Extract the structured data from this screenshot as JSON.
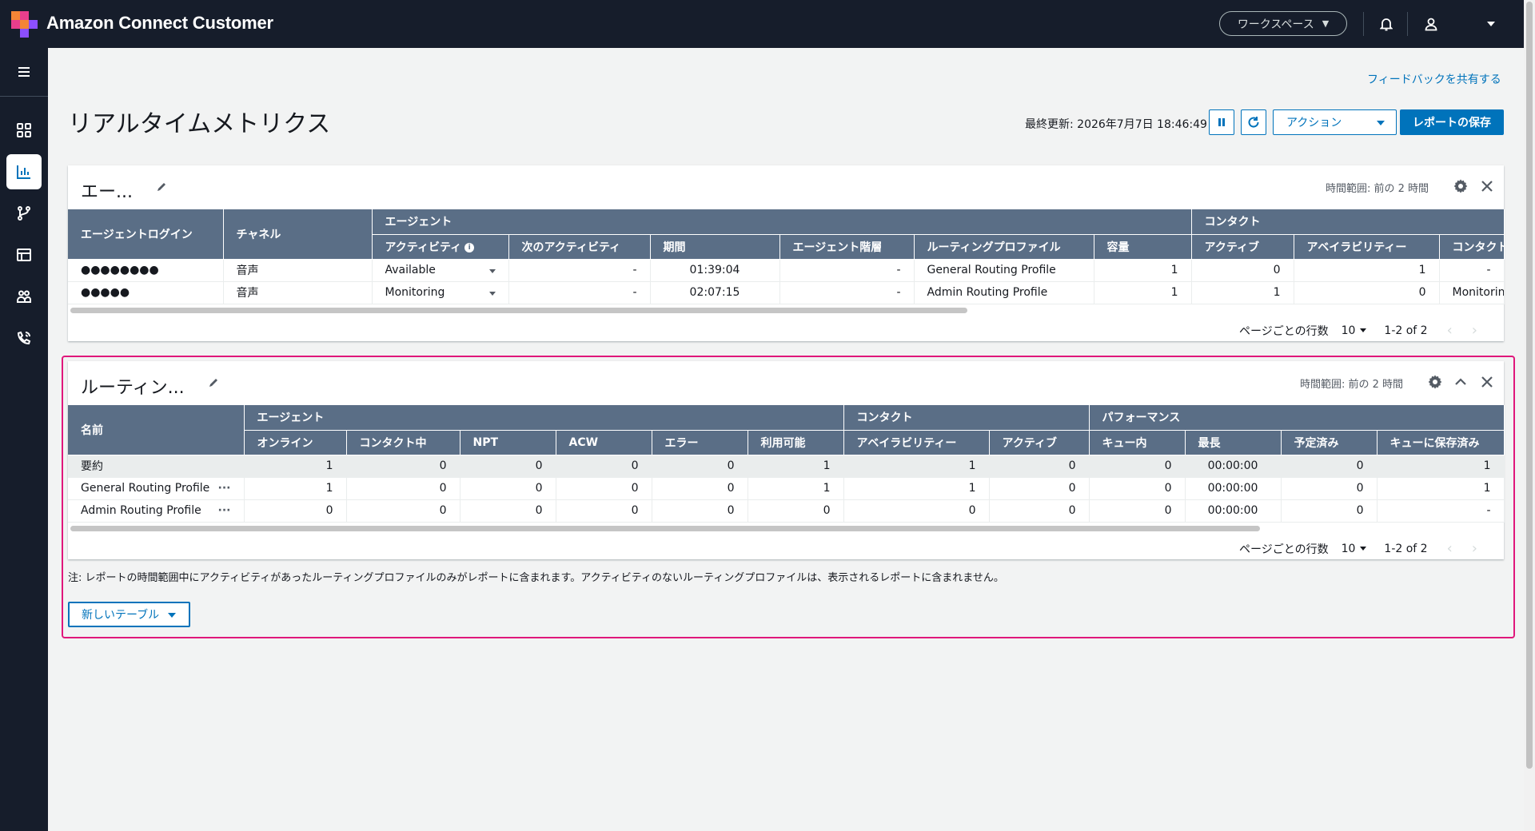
{
  "header": {
    "brand": "Amazon Connect Customer",
    "workspace_label": "ワークスペース",
    "icons": [
      "bell-icon",
      "user-icon",
      "caret-down-icon"
    ]
  },
  "sidebar": {
    "items": [
      {
        "name": "menu",
        "icon": "hamburger-icon"
      },
      {
        "name": "dashboard",
        "icon": "grid-icon"
      },
      {
        "name": "analytics",
        "icon": "bar-chart-icon",
        "active": true
      },
      {
        "name": "routing",
        "icon": "flow-icon"
      },
      {
        "name": "tables",
        "icon": "table-icon"
      },
      {
        "name": "users",
        "icon": "users-icon"
      },
      {
        "name": "channels",
        "icon": "phone-icon"
      }
    ]
  },
  "page": {
    "feedback_link": "フィードバックを共有する",
    "title": "リアルタイムメトリクス",
    "last_updated": "最終更新: 2026年7月7日 18:46:49",
    "action_label": "アクション",
    "save_label": "レポートの保存"
  },
  "agent_panel": {
    "title": "エー...",
    "time_range": "時間範囲: 前の 2 時間",
    "group_headers": {
      "agent": "エージェント",
      "contact": "コンタクト"
    },
    "col_login": "エージェントログイン",
    "col_channel": "チャネル",
    "columns": [
      "アクティビティ",
      "次のアクティビティ",
      "期間",
      "エージェント階層",
      "ルーティングプロファイル",
      "容量",
      "アクティブ",
      "アベイラビリティー",
      "コンタクト状態"
    ],
    "rows": [
      {
        "login": "●●●●●●●●",
        "channel": "音声",
        "activity": "Available",
        "next": "-",
        "duration": "01:39:04",
        "hierarchy": "-",
        "profile": "General Routing Profile",
        "capacity": "1",
        "active": "0",
        "availability": "1",
        "state": "-"
      },
      {
        "login": "●●●●●",
        "channel": "音声",
        "activity": "Monitoring",
        "next": "-",
        "duration": "02:07:15",
        "hierarchy": "-",
        "profile": "Admin Routing Profile",
        "capacity": "1",
        "active": "1",
        "availability": "0",
        "state": "Monitoring"
      }
    ],
    "pager": {
      "rows_label": "ページごとの行数",
      "page_size": "10",
      "range": "1-2 of 2"
    }
  },
  "routing_panel": {
    "title": "ルーティン...",
    "time_range": "時間範囲: 前の 2 時間",
    "col_name": "名前",
    "group_headers": {
      "agent": "エージェント",
      "contact": "コンタクト",
      "performance": "パフォーマンス"
    },
    "columns": [
      "オンライン",
      "コンタクト中",
      "NPT",
      "ACW",
      "エラー",
      "利用可能",
      "アベイラビリティー",
      "アクティブ",
      "キュー内",
      "最長",
      "予定済み",
      "キューに保存済み"
    ],
    "rows": [
      {
        "name": "要約",
        "more": "",
        "values": [
          "1",
          "0",
          "0",
          "0",
          "0",
          "1",
          "1",
          "0",
          "0",
          "00:00:00",
          "0",
          "1"
        ]
      },
      {
        "name": "General Routing Profile",
        "more": "···",
        "values": [
          "1",
          "0",
          "0",
          "0",
          "0",
          "1",
          "1",
          "0",
          "0",
          "00:00:00",
          "0",
          "1"
        ]
      },
      {
        "name": "Admin Routing Profile",
        "more": "···",
        "values": [
          "0",
          "0",
          "0",
          "0",
          "0",
          "0",
          "0",
          "0",
          "0",
          "00:00:00",
          "0",
          "-"
        ]
      }
    ],
    "pager": {
      "rows_label": "ページごとの行数",
      "page_size": "10",
      "range": "1-2 of 2"
    }
  },
  "note": "注: レポートの時間範囲中にアクティビティがあったルーティングプロファイルのみがレポートに含まれます。アクティビティのないルーティングプロファイルは、表示されるレポートに含まれません。",
  "new_table_label": "新しいテーブル",
  "colors": {
    "nav_bg": "#161d2b",
    "accent": "#0073bb",
    "table_header": "#5a6e86",
    "highlight": "#e0177b"
  }
}
